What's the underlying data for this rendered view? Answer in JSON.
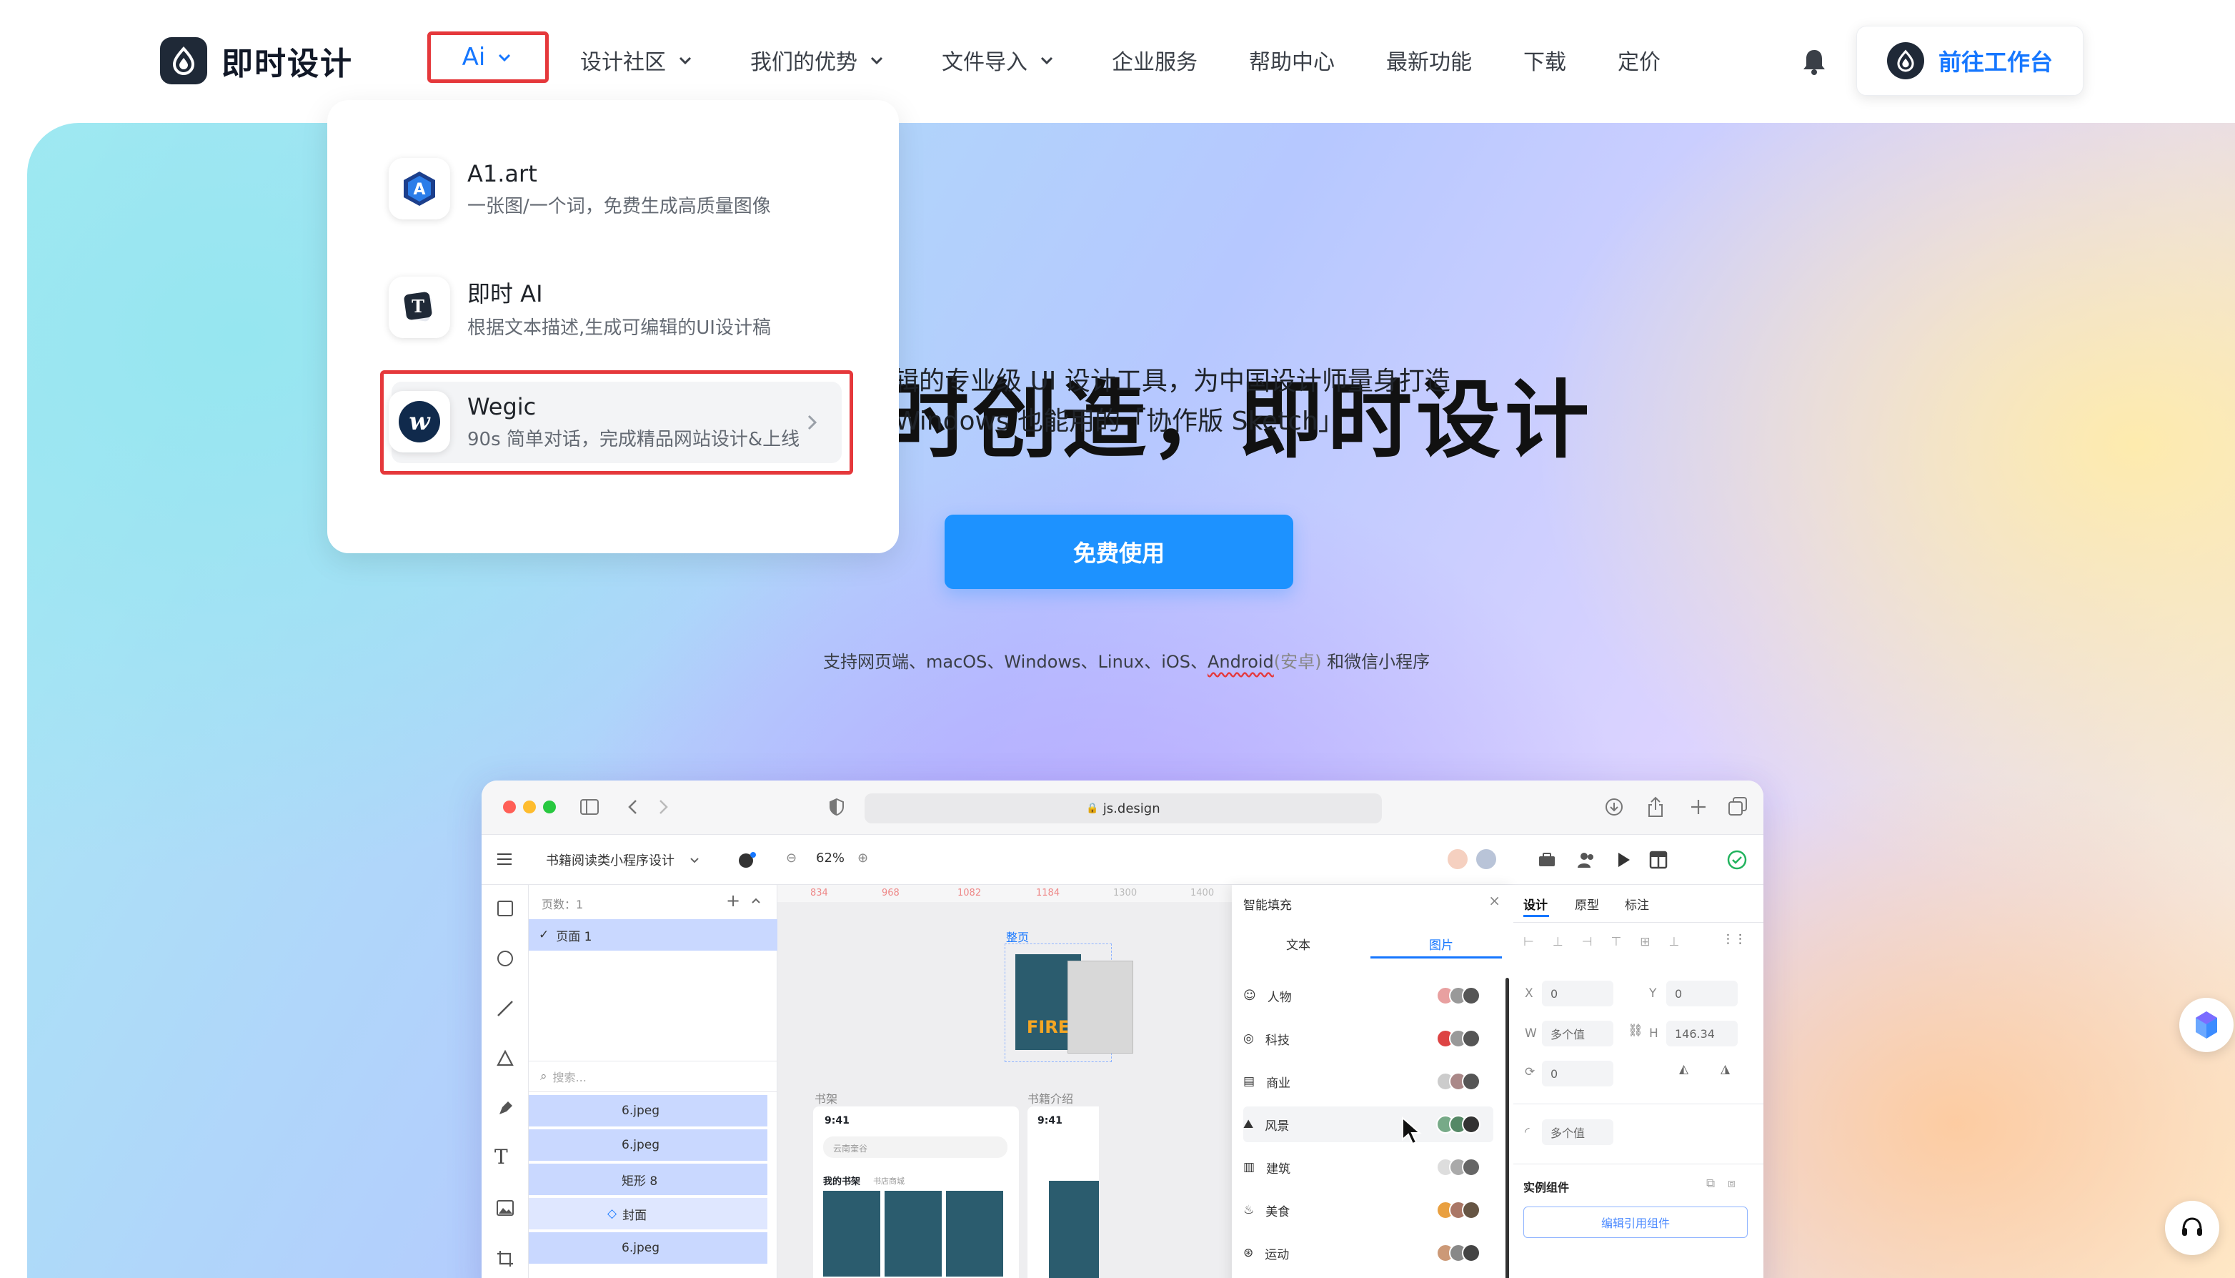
{
  "brand": {
    "name": "即时设计"
  },
  "nav": {
    "ai": "Ai",
    "items": [
      "设计社区",
      "我们的优势",
      "文件导入",
      "企业服务",
      "帮助中心",
      "最新功能",
      "下载",
      "定价"
    ],
    "workbench": "前往工作台"
  },
  "dropdown": {
    "items": [
      {
        "title": "A1.art",
        "desc": "一张图/一个词，免费生成高质量图像"
      },
      {
        "title": "即时 AI",
        "desc": "根据文本描述,生成可编辑的UI设计稿"
      },
      {
        "title": "Wegic",
        "desc": "90s 简单对话，完成精品网站设计&上线"
      }
    ]
  },
  "hero": {
    "title": "时创造，即时设计",
    "sub1": "辑的专业级 UI 设计工具，为中国设计师量身打造",
    "sub2": "Windows 也能用的「协作版 Sketch」",
    "cta": "免费使用",
    "platforms_a": "支持网页端、macOS、Windows、Linux、iOS、",
    "platforms_android": "Android",
    "platforms_paren": "(安卓)",
    "platforms_b": " 和微信小程序"
  },
  "app": {
    "url": "js.design",
    "file": "书籍阅读类小程序设计",
    "zoom": "62%",
    "pages_label": "页数：1",
    "page1": "页面 1",
    "search": "搜索...",
    "layers": [
      "6.jpeg",
      "6.jpeg",
      "矩形 8",
      "封面",
      "6.jpeg"
    ],
    "ruler": [
      "834",
      "968",
      "1082",
      "1184",
      "1300",
      "1400"
    ],
    "frame_label": "整页",
    "shelf_label": "书架",
    "intro_label": "书籍介绍",
    "time": "9:41",
    "search_ph": "云南奎谷",
    "myshelf": "我的书架",
    "bookstore": "书店商城",
    "cover_text": "FIRE",
    "smartfill": {
      "title": "智能填充",
      "tab_text": "文本",
      "tab_image": "图片",
      "rows": [
        "人物",
        "科技",
        "商业",
        "风景",
        "建筑",
        "美食",
        "运动"
      ]
    },
    "right": {
      "tabs": [
        "设计",
        "原型",
        "标注"
      ],
      "x_label": "X",
      "x": "0",
      "y_label": "Y",
      "y": "0",
      "w_label": "W",
      "w": "多个值",
      "h_label": "H",
      "h": "146.34",
      "rot": "0",
      "radius": "多个值",
      "instance": "实例组件",
      "edit_btn": "编辑引用组件"
    }
  }
}
